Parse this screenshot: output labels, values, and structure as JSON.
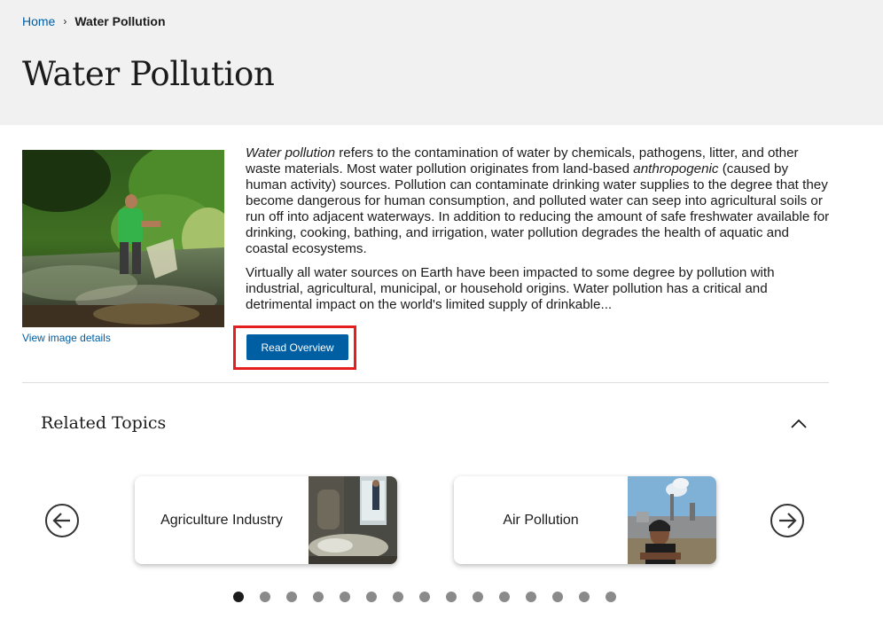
{
  "breadcrumb": {
    "home": "Home",
    "separator": "›",
    "current": "Water Pollution"
  },
  "page_title": "Water Pollution",
  "hero": {
    "image_details_link": "View image details"
  },
  "intro": {
    "p1_italic_1": "Water pollution",
    "p1_text_1": " refers to the contamination of water by chemicals, pathogens, litter, and other waste materials. Most water pollution originates from land-based ",
    "p1_italic_2": "anthropogenic",
    "p1_text_2": " (caused by human activity) sources. Pollution can contaminate drinking water supplies to the degree that they become dangerous for human consumption, and polluted water can seep into agricultural soils or run off into adjacent waterways. In addition to reducing the amount of safe freshwater available for drinking, cooking, bathing, and irrigation, water pollution degrades the health of aquatic and coastal ecosystems.",
    "p2": "Virtually all water sources on Earth have been impacted to some degree by pollution with industrial, agricultural, municipal, or household origins. Water pollution has a critical and detrimental impact on the world's limited supply of drinkable..."
  },
  "read_overview_label": "Read Overview",
  "related": {
    "title": "Related Topics",
    "cards": [
      {
        "label": "Agriculture Industry"
      },
      {
        "label": "Air Pollution"
      }
    ],
    "dots_total": 15,
    "active_dot": 1
  },
  "colors": {
    "link": "#005ea2",
    "button": "#005ea2",
    "highlight": "#e41f1f",
    "header_bg": "#f1f1f1"
  }
}
